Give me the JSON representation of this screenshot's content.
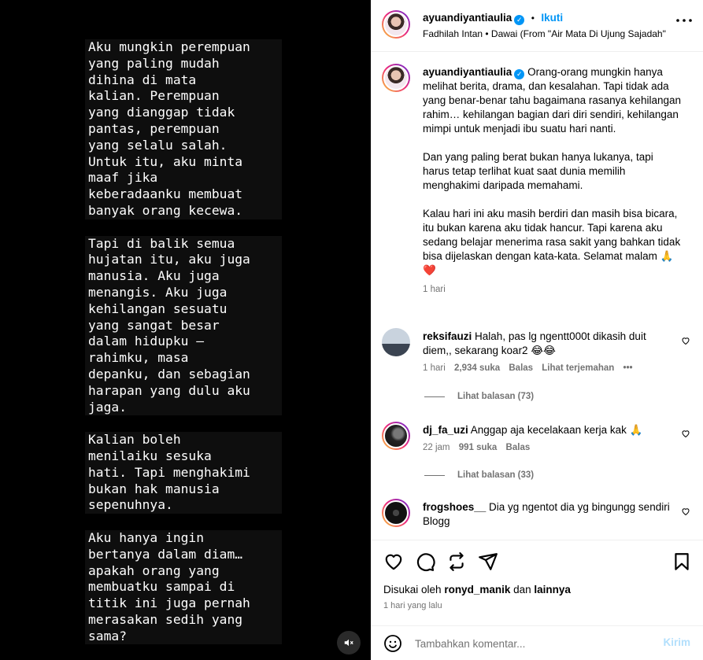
{
  "story": {
    "paragraphs": [
      "Aku mungkin perempuan\nyang paling mudah\ndihina di mata\nkalian. Perempuan\nyang dianggap tidak\npantas, perempuan\nyang selalu salah.\nUntuk itu, aku minta\nmaaf jika\nkeberadaanku membuat\nbanyak orang kecewa.",
      "Tapi di balik semua\nhujatan itu, aku juga\nmanusia. Aku juga\nmenangis. Aku juga\nkehilangan sesuatu\nyang sangat besar\ndalam hidupku —\nrahimku, masa\ndepanku, dan sebagian\nharapan yang dulu aku\njaga.",
      "Kalian boleh\nmenilaiku sesuka\nhati. Tapi menghakimi\nbukan hak manusia\nsepenuhnya.",
      "Aku hanya ingin\nbertanya dalam diam…\napakah orang yang\nmembuatku sampai di\ntitik ini juga pernah\nmerasakan sedih yang\nsama?"
    ]
  },
  "header": {
    "username": "ayuandiyantiaulia",
    "separator": "•",
    "follow_label": "Ikuti",
    "audio": "Fadhilah Intan • Dawai (From \"Air Mata Di Ujung Sajadah\""
  },
  "caption": {
    "username": "ayuandiyantiaulia",
    "paragraphs": [
      "Orang-orang mungkin hanya melihat berita, drama, dan kesalahan. Tapi tidak ada yang benar-benar tahu bagaimana rasanya kehilangan rahim… kehilangan bagian dari diri sendiri, kehilangan mimpi untuk menjadi ibu suatu hari nanti.",
      "Dan yang paling berat bukan hanya lukanya, tapi harus tetap terlihat kuat saat dunia memilih menghakimi daripada memahami.",
      "Kalau hari ini aku masih berdiri dan masih bisa bicara, itu bukan karena aku tidak hancur. Tapi karena aku sedang belajar menerima rasa sakit yang bahkan tidak bisa dijelaskan dengan kata-kata. Selamat malam 🙏❤️"
    ],
    "time": "1 hari"
  },
  "comments": [
    {
      "username": "reksifauzi",
      "text": "Halah, pas lg ngentt000t dikasih duit diem,, sekarang koar2 😂😂",
      "time": "1 hari",
      "likes": "2,934 suka",
      "reply_label": "Balas",
      "translate_label": "Lihat terjemahan",
      "more_label": "•••",
      "view_replies": "Lihat balasan (73)"
    },
    {
      "username": "dj_fa_uzi",
      "text": "Anggap aja kecelakaan kerja kak 🙏",
      "time": "22 jam",
      "likes": "991 suka",
      "reply_label": "Balas",
      "view_replies": "Lihat balasan (33)"
    },
    {
      "username": "frogshoes__",
      "text": "Dia yg ngentot dia yg bingungg sendiri\nBlogg"
    }
  ],
  "actions": {
    "liked_by_prefix": "Disukai oleh",
    "liked_by_user": "ronyd_manik",
    "liked_by_and": "dan",
    "liked_by_others": "lainnya",
    "time": "1 hari yang lalu"
  },
  "composer": {
    "placeholder": "Tambahkan komentar...",
    "send_label": "Kirim"
  },
  "colors": {
    "accent": "#0095f6",
    "muted": "#737373",
    "like_red": "#ed4956"
  }
}
